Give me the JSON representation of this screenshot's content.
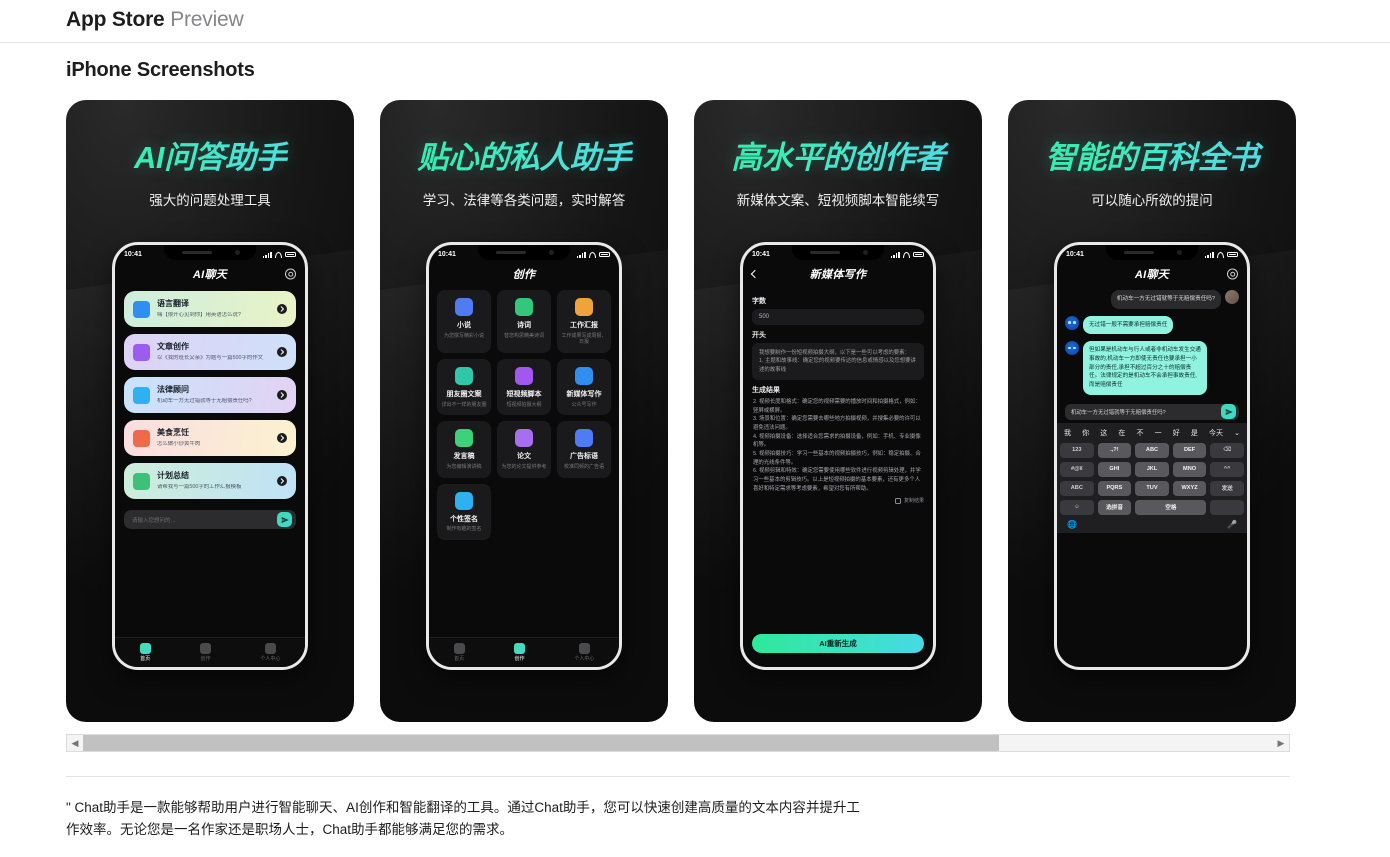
{
  "header": {
    "brand": "App Store",
    "brand_sub": "Preview",
    "section_title": "iPhone Screenshots"
  },
  "phone_status": {
    "time": "10:41"
  },
  "scrollbar": {
    "left_arrow": "◀",
    "right_arrow": "▶"
  },
  "footer": {
    "description": "\" Chat助手是一款能够帮助用户进行智能聊天、AI创作和智能翻译的工具。通过Chat助手，您可以快速创建高质量的文本内容并提升工作效率。无论您是一名作家还是职场人士，Chat助手都能够满足您的需求。"
  },
  "shots": [
    {
      "title": "AI问答助手",
      "subtitle": "强大的问题处理工具",
      "app_title": "AI聊天",
      "cards": [
        {
          "title": "语言翻译",
          "desc": "嗨【很开心见到你】用英语怎么说?",
          "color1": "#cdeedd",
          "color2": "#e9f3c6",
          "icon": "#2f8ef0"
        },
        {
          "title": "文章创作",
          "desc": "以《我的班长父亲》为题写一篇500字的作文",
          "color1": "#ded2f5",
          "color2": "#cfe0fa",
          "icon": "#9b5cf0"
        },
        {
          "title": "法律顾问",
          "desc": "机动车一方无过错就等于无赔偿责任吗?",
          "color1": "#c9e3fb",
          "color2": "#e3d2f3",
          "icon": "#2fb0f0"
        },
        {
          "title": "美食烹饪",
          "desc": "怎么做小炒黄牛肉",
          "color1": "#fbdde1",
          "color2": "#fbf2cf",
          "icon": "#f06a4a"
        },
        {
          "title": "计划总结",
          "desc": "请帮我写一篇500字的工作汇报模板",
          "color1": "#cdeed9",
          "color2": "#bfe2f7",
          "icon": "#3fc07a"
        }
      ],
      "input_placeholder": "请输入您想问的…",
      "tabs": [
        {
          "label": "首页",
          "active": true
        },
        {
          "label": "创作",
          "active": false
        },
        {
          "label": "个人中心",
          "active": false
        }
      ]
    },
    {
      "title": "贴心的私人助手",
      "subtitle": "学习、法律等各类问题，实时解答",
      "app_title": "创作",
      "grid": [
        {
          "title": "小说",
          "desc": "为您撰写精彩小说",
          "icon": "#4f7cf5"
        },
        {
          "title": "诗词",
          "desc": "替您构思精美诗词",
          "icon": "#34c77b"
        },
        {
          "title": "工作汇报",
          "desc": "工作成果写成周报、日报",
          "icon": "#f0a23c"
        },
        {
          "title": "朋友圈文案",
          "desc": "详出不一样的朋友圈",
          "icon": "#2fc7a8"
        },
        {
          "title": "短视频脚本",
          "desc": "短视频拍摄大纲",
          "icon": "#a257f0"
        },
        {
          "title": "新媒体写作",
          "desc": "公众号写作",
          "icon": "#2f8ef0"
        },
        {
          "title": "发言稿",
          "desc": "为您编辑演讲稿",
          "icon": "#3fd07a"
        },
        {
          "title": "论文",
          "desc": "为您的论文提供参考",
          "icon": "#a86ef0"
        },
        {
          "title": "广告标语",
          "desc": "校准同频的广告语",
          "icon": "#4f7cf5"
        },
        {
          "title": "个性签名",
          "desc": "制作有趣的签名",
          "icon": "#2fb0f0"
        }
      ],
      "tabs": [
        {
          "label": "首页",
          "active": false
        },
        {
          "label": "创作",
          "active": true
        },
        {
          "label": "个人中心",
          "active": false
        }
      ]
    },
    {
      "title": "高水平的创作者",
      "subtitle": "新媒体文案、短视频脚本智能续写",
      "app_title": "新媒体写作",
      "form": {
        "count_label": "字数",
        "count_value": "500",
        "start_label": "开头",
        "start_value": "我想要制作一份短视频拍摄大纲，以下是一些可以考虑的要素：\n1. 主题和故事线：确定您的视频要传达的信息或情感以及您想要讲述的故事线",
        "result_label": "生成结果",
        "result_value": "2. 视频长度和格式：确定您的视频需要的播放时间和拍摄格式，例如：竖屏或横屏。\n3. 场景和位置：确定您需要去哪些地方拍摄视频，并搜集必要的许可以避免违法问题。\n4. 视频拍摄设备：选择适合您需求的拍摄设备，例如：手机、专业摄像机等。\n5. 视频拍摄技巧：学习一些基本的视频拍摄技巧，例如：稳定拍摄、合理的光线条件等。\n6. 视频剪辑和特效：确定您需要使用哪些软件进行视频剪辑处理，并学习一些基本的剪辑技巧。以上是短视频拍摄的基本要素，还有更多个人喜好和特定需求等考虑要素，希望对您有所帮助。",
        "copy_label": "复制结果",
        "regen_label": "AI重新生成"
      }
    },
    {
      "title": "智能的百科全书",
      "subtitle": "可以随心所欲的提问",
      "app_title": "AI聊天",
      "messages": [
        {
          "from": "me",
          "text": "机动车一方无过错就等于无赔偿责任吗?"
        },
        {
          "from": "ai",
          "text": "无过错一般不需要承担赔偿责任"
        },
        {
          "from": "ai",
          "text": "但如果是机动车与行人或者非机动车发生交通事故的,机动车一方即使无责任也要承担一小部分的责任,承担不超过百分之十的赔偿责任。法律规定的是机动车不会承担事故责任,而是赔偿责任"
        }
      ],
      "input_value": "机动车一方无过错就等于无赔偿责任吗?",
      "keyboard": {
        "suggestions": [
          "我",
          "你",
          "这",
          "在",
          "不",
          "一",
          "好",
          "是",
          "今天"
        ],
        "rows": [
          [
            "123",
            ".,?!",
            "ABC",
            "DEF",
            "⌫"
          ],
          [
            "#@¥",
            "GHI",
            "JKL",
            "MNO",
            "^^"
          ],
          [
            "ABC",
            "PQRS",
            "TUV",
            "WXYZ",
            "发送"
          ],
          [
            "☺",
            "选拼音",
            "空格"
          ]
        ],
        "globe": "🌐",
        "mic": "🎤"
      }
    }
  ]
}
